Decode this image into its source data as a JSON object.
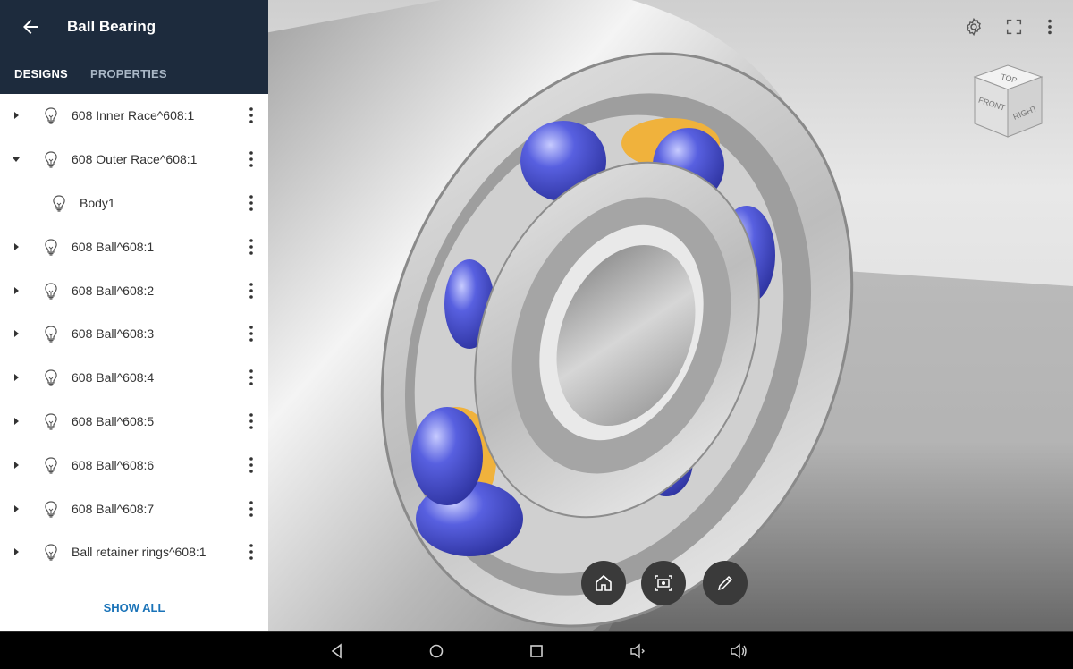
{
  "header": {
    "title": "Ball Bearing"
  },
  "tabs": [
    {
      "label": "DESIGNS"
    },
    {
      "label": "PROPERTIES"
    }
  ],
  "tree": [
    {
      "label": "608 Inner Race^608:1",
      "state": "collapsed"
    },
    {
      "label": "608 Outer Race^608:1",
      "state": "expanded"
    },
    {
      "label": "Body1",
      "state": "child"
    },
    {
      "label": "608 Ball^608:1",
      "state": "collapsed"
    },
    {
      "label": "608 Ball^608:2",
      "state": "collapsed"
    },
    {
      "label": "608 Ball^608:3",
      "state": "collapsed"
    },
    {
      "label": "608 Ball^608:4",
      "state": "collapsed"
    },
    {
      "label": "608 Ball^608:5",
      "state": "collapsed"
    },
    {
      "label": "608 Ball^608:6",
      "state": "collapsed"
    },
    {
      "label": "608 Ball^608:7",
      "state": "collapsed"
    },
    {
      "label": "Ball retainer rings^608:1",
      "state": "collapsed"
    }
  ],
  "show_all_label": "SHOW ALL",
  "viewcube": {
    "top": "TOP",
    "front": "FRONT",
    "right": "RIGHT"
  },
  "viewer_icons": [
    "settings-icon",
    "fullscreen-icon",
    "more-vert-icon"
  ],
  "fab_icons": [
    "home-icon",
    "screenshot-icon",
    "markup-pencil-icon"
  ],
  "nav_icons": [
    "back-triangle-icon",
    "home-circle-icon",
    "recents-square-icon",
    "volume-down-icon",
    "volume-up-icon"
  ],
  "colors": {
    "header_bg": "#1d2b3d",
    "accent_link": "#1a73b8",
    "ball_blue": "#4a52d6",
    "retainer_yellow": "#f0b23c",
    "metal": "#d9d9d9"
  }
}
